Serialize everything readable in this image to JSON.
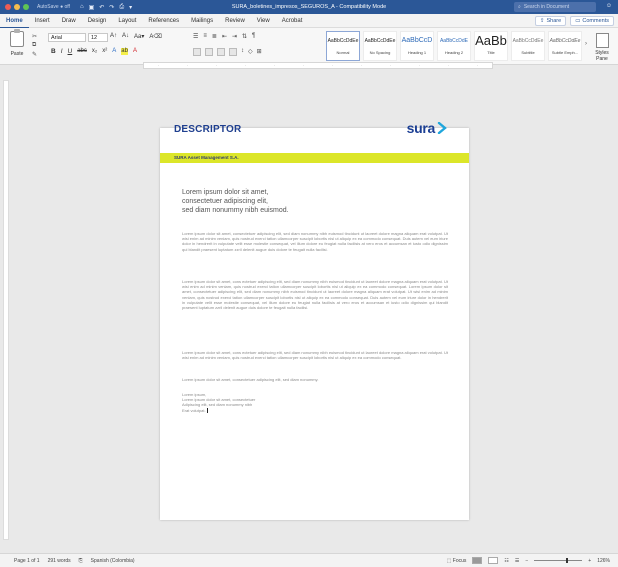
{
  "titlebar": {
    "autosave": "AutoSave ● off",
    "doc_title": "SURA_boletines_impresos_SEGUROS_A  -  Compatibility Mode",
    "search_placeholder": "Search in Document",
    "colors": {
      "close": "#ee5c54",
      "minimize": "#f5bd4f",
      "zoom": "#5fc454"
    }
  },
  "tabs": [
    "Home",
    "Insert",
    "Draw",
    "Design",
    "Layout",
    "References",
    "Mailings",
    "Review",
    "View",
    "Acrobat"
  ],
  "tab_actions": {
    "share": "Share",
    "comments": "Comments"
  },
  "ribbon": {
    "paste_label": "Paste",
    "font_name": "Arial",
    "font_size": "12",
    "styles": [
      {
        "preview": "AaBbCcDdEe",
        "name": "Normal"
      },
      {
        "preview": "AaBbCcDdEe",
        "name": "No Spacing"
      },
      {
        "preview": "AaBbCcD",
        "name": "Heading 1"
      },
      {
        "preview": "AaBbCcDdE",
        "name": "Heading 2"
      },
      {
        "preview": "AaBb",
        "name": "Title"
      },
      {
        "preview": "AaBbCcDdEe",
        "name": "Subtitle"
      },
      {
        "preview": "AaBbCcDdEe",
        "name": "Subtle Emph..."
      }
    ],
    "styles_pane": "Styles Pane"
  },
  "document": {
    "heading": "DESCRIPTOR",
    "logo": "sura",
    "company": "SURA Asset Management S.A.",
    "subtitle_lines": [
      "Lorem ipsum dolor sit amet,",
      "consectetuer adipiscing elit,",
      "sed diam nonummy nibh euismod."
    ],
    "paragraphs": [
      "Lorem ipsum dolor sit amet, consectetuer adipiscing elit, sed diam nonummy nibh euismod tincidunt ut laoreet dolore magna aliquam erat volutpat. Ut wisi enim ad minim veniam, quis nostrud exerci tation ullamcorper suscipit lobortis nisl ut aliquip ex ea commodo consequat. Duis autem vel eum iriure dolor in hendrerit in vulputate velit esse molestie consequat, vel illum dolore eu feugiat nulla facilisis at vero eros et accumsan et iusto odio dignissim qui blandit praesent luptatum zzril delenit augue duis dolore te feugait nulla facilisi.",
      "Lorem ipsum dolor sit amet, cons ectetuer adipiscing elit, sed diam nonummy nibh euismod tincidunt ut laoreet dolore magna aliquam erat volutpat. Ut wisi enim ad minim veniam, quis nostrud exerci tation ullamcorper suscipit lobortis nisl ut aliquip ex ea commodo consequat. Lorem ipsum dolor sit amet, consectetuer adipiscing elit, sed diam nonummy nibh euismod tincidunt ut laoreet dolore magna aliquam erat volutpat. Ut wisi enim ad minim veniam, quis nostrud exerci tation ullamcorper suscipit lobortis nisl ut aliquip ex ea commodo consequat. Duis autem vel eum iriure dolor in hendrerit in vulputate velit esse molestie consequat, vel illum dolore eu feugiat nulla facilisis at vero eros et accumsan et iusto odio dignissim qui blandit praesent luptatum zzril delenit augue duis dolore te feugait nulla facilisi.",
      "Lorem ipsum dolor sit amet, cons ectetuer adipiscing elit, sed diam nonummy nibh euismod tincidunt ut laoreet dolore magna aliquam erat volutpat. Ut wisi enim ad minim veniam, quis nostrud exerci tation ullamcorper suscipit lobortis nisl ut aliquip ex ea commodo consequat.",
      "Lorem ipsum dolor sit amet, consectetuer adipiscing elit, sed diam nonummy."
    ],
    "closing_lines": [
      "Lorem ipsum,",
      "Lorem ipsum dolor sit amet, consectetuer",
      "Adipiscing elit, sed diam nonummy nibh",
      "Erat volutpat."
    ]
  },
  "statusbar": {
    "page": "Page 1 of 1",
    "words": "291 words",
    "language": "Spanish (Colombia)",
    "focus": "Focus",
    "zoom": "126%"
  }
}
